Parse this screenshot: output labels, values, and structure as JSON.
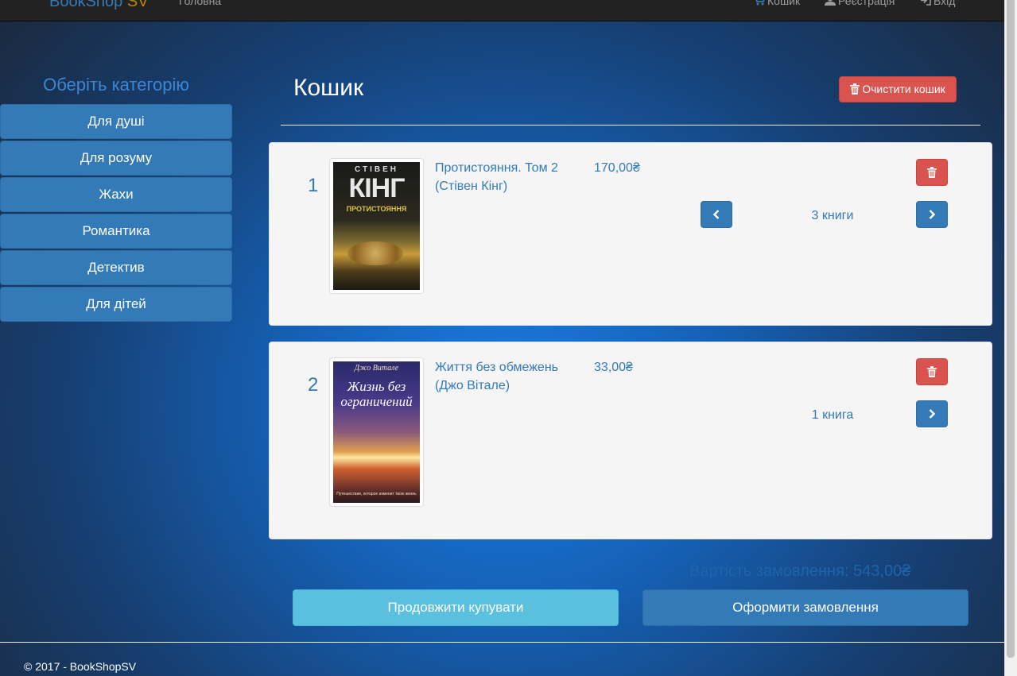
{
  "navbar": {
    "brand_main": "BookShop",
    "brand_suffix": "SV",
    "home": "Головна",
    "cart": "Кошик",
    "register": "Реєстрація",
    "login": "Вхід"
  },
  "sidebar": {
    "title": "Оберіть категорію",
    "categories": [
      {
        "label": "Для душі"
      },
      {
        "label": "Для розуму"
      },
      {
        "label": "Жахи"
      },
      {
        "label": "Романтика"
      },
      {
        "label": "Детектив"
      },
      {
        "label": "Для дітей"
      }
    ]
  },
  "cart": {
    "title": "Кошик",
    "clear_label": "Очистити кошик",
    "items": [
      {
        "index": "1",
        "title": "Протистояння. Том 2 (Стівен Кінг)",
        "price": "170,00₴",
        "quantity": "3 книги",
        "cover": {
          "author": "СТІВЕН",
          "author_big": "КІНГ",
          "book": "ПРОТИСТОЯННЯ"
        }
      },
      {
        "index": "2",
        "title": "Життя без обмежень (Джо Вітале)",
        "price": "33,00₴",
        "quantity": "1 книга",
        "cover": {
          "author": "Джо Витале",
          "book": "Жизнь без ограничений",
          "tagline": "Путешествие, которое изменит твою жизнь"
        }
      }
    ],
    "total": "Вартість замовлення: 543,00₴",
    "continue_label": "Продовжити купувати",
    "checkout_label": "Оформити замовлення"
  },
  "footer": {
    "text": "© 2017 - BookShopSV"
  },
  "colors": {
    "primary": "#337ab7",
    "danger": "#d9534f",
    "info": "#5bc0de",
    "navbar": "#222222"
  },
  "icons": [
    "shopping-cart-icon",
    "user-icon",
    "log-in-icon",
    "trash-icon",
    "chevron-left-icon",
    "chevron-right-icon"
  ]
}
